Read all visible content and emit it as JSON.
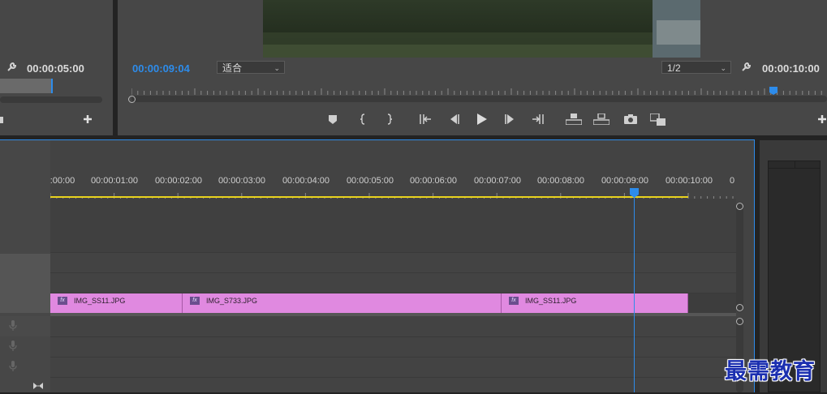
{
  "source_monitor": {
    "timecode": "00:00:05:00"
  },
  "program_monitor": {
    "current_timecode": "00:00:09:04",
    "zoom_select": "适合",
    "resolution_select": "1/2",
    "duration_timecode": "00:00:10:00",
    "playhead_progress": 0.916
  },
  "transport": {
    "buttons": [
      "marker",
      "mark-in",
      "mark-out",
      "go-to-in",
      "step-back",
      "play",
      "step-forward",
      "go-to-out",
      "lift",
      "extract",
      "export-frame",
      "compare"
    ]
  },
  "timeline": {
    "ruler_labels": [
      ":00:00",
      "00:00:01:00",
      "00:00:02:00",
      "00:00:03:00",
      "00:00:04:00",
      "00:00:05:00",
      "00:00:06:00",
      "00:00:07:00",
      "00:00:08:00",
      "00:00:09:00",
      "00:00:10:00",
      "0"
    ],
    "clips": [
      {
        "name": "IMG_SS11.JPG"
      },
      {
        "name": "IMG_S733.JPG"
      },
      {
        "name": "IMG_SS11.JPG"
      }
    ],
    "fx_label": "fx"
  },
  "watermark": "最需教育",
  "colors": {
    "accent_blue": "#2d8ceb",
    "clip_pink": "#e089e0",
    "work_area_yellow": "#e8d21d",
    "watermark_blue": "#1b2fb0"
  }
}
